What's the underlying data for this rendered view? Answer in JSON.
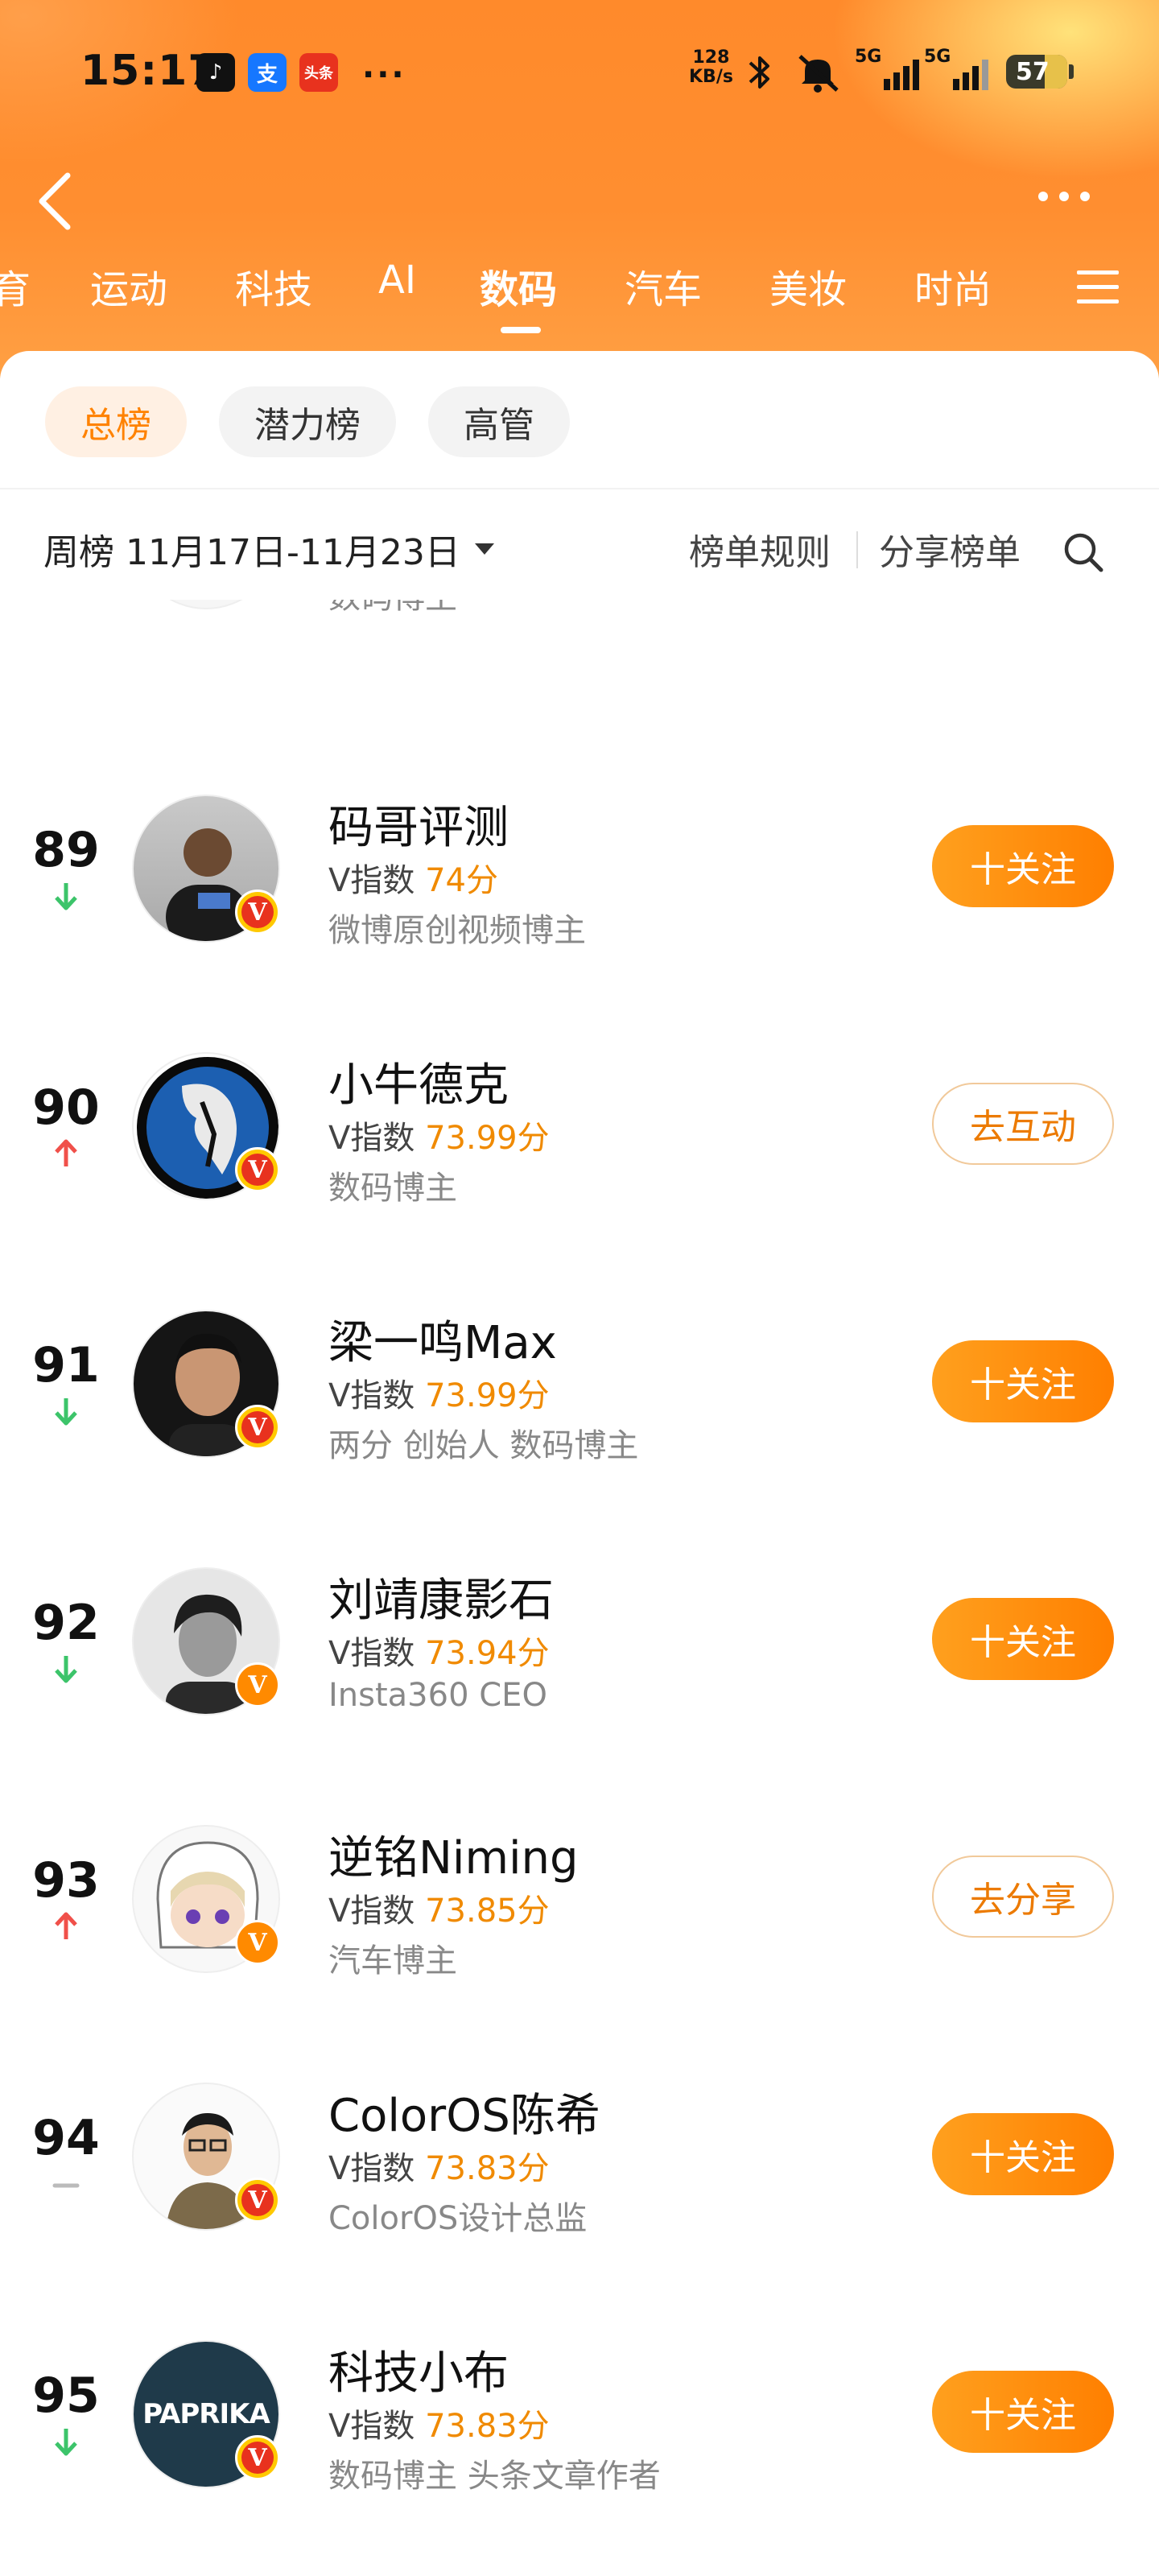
{
  "status_bar": {
    "time": "15:17",
    "app_icons": [
      {
        "name": "douyin-icon",
        "glyph": "♪",
        "color": "#111111"
      },
      {
        "name": "alipay-icon",
        "glyph": "支",
        "color": "#1677ff"
      },
      {
        "name": "toutiao-icon",
        "glyph": "头条",
        "color": "#e8321e"
      }
    ],
    "more_notifications": "···",
    "net_speed_value": "128",
    "net_speed_unit": "KB/s",
    "signal_1": "5G",
    "signal_2": "5G",
    "battery": "57"
  },
  "nav": {
    "back_icon": "chevron-left-icon",
    "more_icon": "more-dots-icon"
  },
  "category_tabs": [
    "育",
    "运动",
    "科技",
    "AI",
    "数码",
    "汽车",
    "美妆",
    "时尚"
  ],
  "active_category": "数码",
  "sub_tabs": [
    {
      "label": "总榜",
      "active": true
    },
    {
      "label": "潜力榜",
      "active": false
    },
    {
      "label": "高管",
      "active": false
    }
  ],
  "period": {
    "label": "周榜",
    "range": "11月17日-11月23日"
  },
  "links": {
    "rules": "榜单规则",
    "share": "分享榜单"
  },
  "partial_row": {
    "desc": "数码博主",
    "trend": "down"
  },
  "rows": [
    {
      "rank": "89",
      "trend": "down",
      "name": "码哥评测",
      "v_label": "V指数",
      "v_score": "74分",
      "desc": "微博原创视频博主",
      "action": "十关注",
      "action_style": "follow",
      "badge": "gold"
    },
    {
      "rank": "90",
      "trend": "up",
      "name": "小牛德克",
      "v_label": "V指数",
      "v_score": "73.99分",
      "desc": "数码博主",
      "action": "去互动",
      "action_style": "outline",
      "badge": "gold"
    },
    {
      "rank": "91",
      "trend": "down",
      "name": "梁一鸣Max",
      "v_label": "V指数",
      "v_score": "73.99分",
      "desc": "两分 创始人 数码博主",
      "action": "十关注",
      "action_style": "follow",
      "badge": "gold"
    },
    {
      "rank": "92",
      "trend": "down",
      "name": "刘靖康影石",
      "v_label": "V指数",
      "v_score": "73.94分",
      "desc": "Insta360 CEO",
      "action": "十关注",
      "action_style": "follow",
      "badge": "orange"
    },
    {
      "rank": "93",
      "trend": "up",
      "name": "逆铭Niming",
      "v_label": "V指数",
      "v_score": "73.85分",
      "desc": "汽车博主",
      "action": "去分享",
      "action_style": "outline",
      "badge": "orange"
    },
    {
      "rank": "94",
      "trend": "same",
      "name": "ColorOS陈希",
      "v_label": "V指数",
      "v_score": "73.83分",
      "desc": "ColorOS设计总监",
      "action": "十关注",
      "action_style": "follow",
      "badge": "gold"
    },
    {
      "rank": "95",
      "trend": "down",
      "name": "科技小布",
      "v_label": "V指数",
      "v_score": "73.83分",
      "desc": "数码博主 头条文章作者",
      "action": "十关注",
      "action_style": "follow",
      "badge": "gold",
      "avatar_text": "PAPRIKA"
    }
  ],
  "colors": {
    "accent": "#ff8200",
    "trend_up": "#f0504a",
    "trend_down": "#3cc46a",
    "trend_same": "#bbbbbb"
  }
}
